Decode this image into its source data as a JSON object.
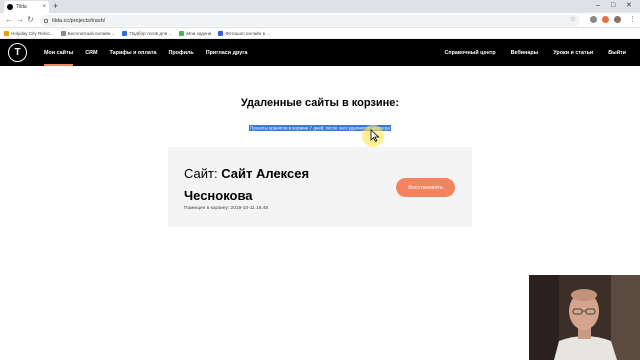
{
  "browser": {
    "tab_title": "Tilda",
    "new_tab": "+",
    "window_controls": [
      "–",
      "□",
      "✕"
    ],
    "url": "tilda.cc/projects/trash/",
    "bookmarks": [
      {
        "label": "Holyday City Reloc...",
        "icon": "holiday-bookmark-icon",
        "color": "#e0a100"
      },
      {
        "label": "Бесплатный онлайн ...",
        "icon": "page-bookmark-icon",
        "color": "#8a8a8a"
      },
      {
        "label": "Подбор тегов для ...",
        "icon": "tag-bookmark-icon",
        "color": "#2c6cd6"
      },
      {
        "label": "Мои задачи",
        "icon": "tasks-bookmark-icon",
        "color": "#4caf50"
      },
      {
        "label": "Фотошоп онлайн в ...",
        "icon": "photoshop-bookmark-icon",
        "color": "#3b5bdb"
      }
    ]
  },
  "site_nav": {
    "logo_letter": "T",
    "left_links": [
      "Мои сайты",
      "CRM",
      "Тарифы и оплата",
      "Профиль",
      "Пригласи друга"
    ],
    "right_links": [
      "Справочный центр",
      "Вебинары",
      "Уроки и статьи",
      "Выйти"
    ],
    "active_link": "Мои сайты"
  },
  "trash": {
    "heading": "Удаленные сайты в корзине:",
    "info": "Проекты хранятся в корзине 7 дней, после чего удаляются навсегда",
    "card": {
      "prefix": "Сайт:",
      "name": "Сайт Алексея Чеснокова",
      "moved": "Помещен в корзину: 2019-10-11 16:48",
      "restore_button": "Восстановить"
    }
  },
  "colors": {
    "accent": "#f4845f",
    "selection": "#3a79d8",
    "nav_bg": "#000000",
    "card_bg": "#f4f4f4"
  }
}
